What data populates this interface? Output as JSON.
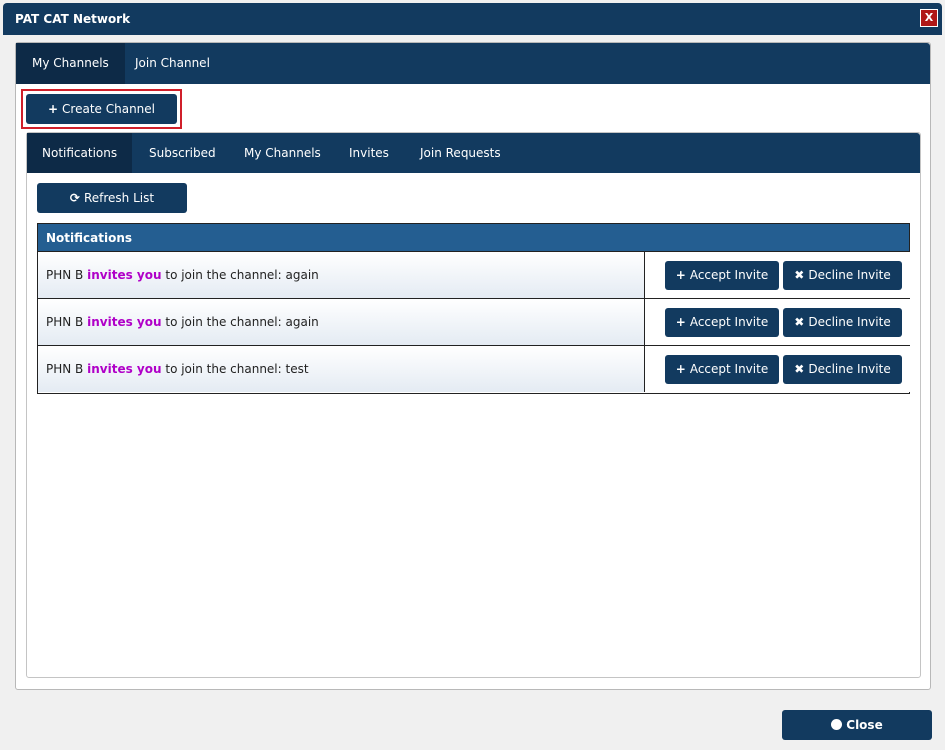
{
  "window": {
    "title": "PAT CAT Network",
    "close_x": "X"
  },
  "top_tabs": [
    {
      "label": "My Channels"
    },
    {
      "label": "Join Channel"
    }
  ],
  "create_button": {
    "icon": "+",
    "label": "Create Channel"
  },
  "inner_tabs": [
    {
      "label": "Notifications"
    },
    {
      "label": "Subscribed"
    },
    {
      "label": "My Channels"
    },
    {
      "label": "Invites"
    },
    {
      "label": "Join Requests"
    }
  ],
  "refresh_button": {
    "icon": "⟳",
    "label": "Refresh List"
  },
  "table": {
    "header": "Notifications",
    "rows": [
      {
        "user": "PHN B",
        "verb": "invites you",
        "text": "to join the channel:",
        "channel": "again",
        "accept": "Accept Invite",
        "decline": "Decline Invite"
      },
      {
        "user": "PHN B",
        "verb": "invites you",
        "text": "to join the channel:",
        "channel": "again",
        "accept": "Accept Invite",
        "decline": "Decline Invite"
      },
      {
        "user": "PHN B",
        "verb": "invites you",
        "text": "to join the channel:",
        "channel": "test",
        "accept": "Accept Invite",
        "decline": "Decline Invite"
      }
    ]
  },
  "close_button": {
    "label": "Close"
  },
  "icons": {
    "plus": "+",
    "times": "✖"
  },
  "colors": {
    "primary": "#123a5f",
    "header": "#245e91",
    "highlight": "#b000c8",
    "focus": "#d01f2a"
  }
}
